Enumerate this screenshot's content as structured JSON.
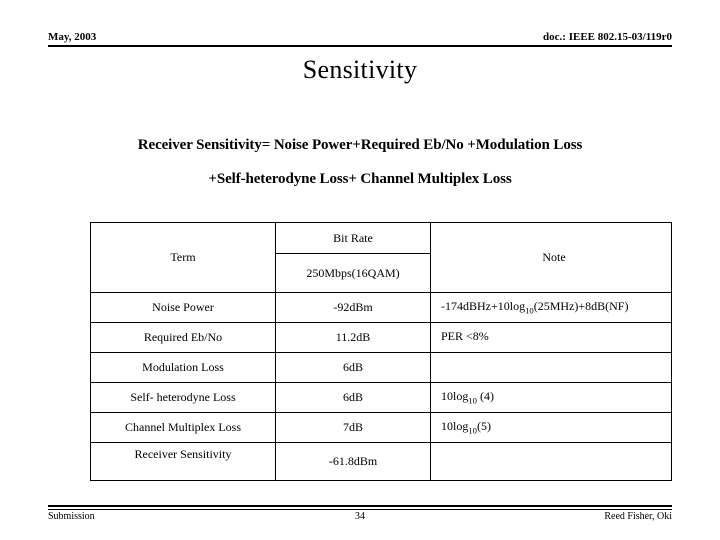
{
  "header": {
    "date": "May, 2003",
    "doc_id": "doc.: IEEE 802.15-03/119r0"
  },
  "title": "Sensitivity",
  "formula": {
    "line1": "Receiver Sensitivity= Noise Power+Required Eb/No +Modulation Loss",
    "line2": "+Self-heterodyne Loss+ Channel Multiplex Loss"
  },
  "table": {
    "headers": {
      "term": "Term",
      "bit_rate": "Bit Rate",
      "bit_rate_value": "250Mbps(16QAM)",
      "note": "Note"
    },
    "rows": [
      {
        "term": "Noise Power",
        "value": "-92dBm",
        "note_pre": "-174dBHz+10log",
        "note_sub": "10",
        "note_post": "(25MHz)+8dB(NF)"
      },
      {
        "term": "Required Eb/No",
        "value": "11.2dB",
        "note_pre": "PER <8%",
        "note_sub": "",
        "note_post": ""
      },
      {
        "term": "Modulation Loss",
        "value": "6dB",
        "note_pre": "",
        "note_sub": "",
        "note_post": ""
      },
      {
        "term": "Self- heterodyne Loss",
        "value": "6dB",
        "note_pre": "10log",
        "note_sub": "10",
        "note_post": " (4)"
      },
      {
        "term": "Channel Multiplex Loss",
        "value": "7dB",
        "note_pre": "10log",
        "note_sub": "10",
        "note_post": "(5)"
      },
      {
        "term": "Receiver Sensitivity",
        "value": "-61.8dBm",
        "note_pre": "",
        "note_sub": "",
        "note_post": ""
      }
    ]
  },
  "footer": {
    "left": "Submission",
    "page": "34",
    "right": "Reed Fisher, Oki"
  }
}
